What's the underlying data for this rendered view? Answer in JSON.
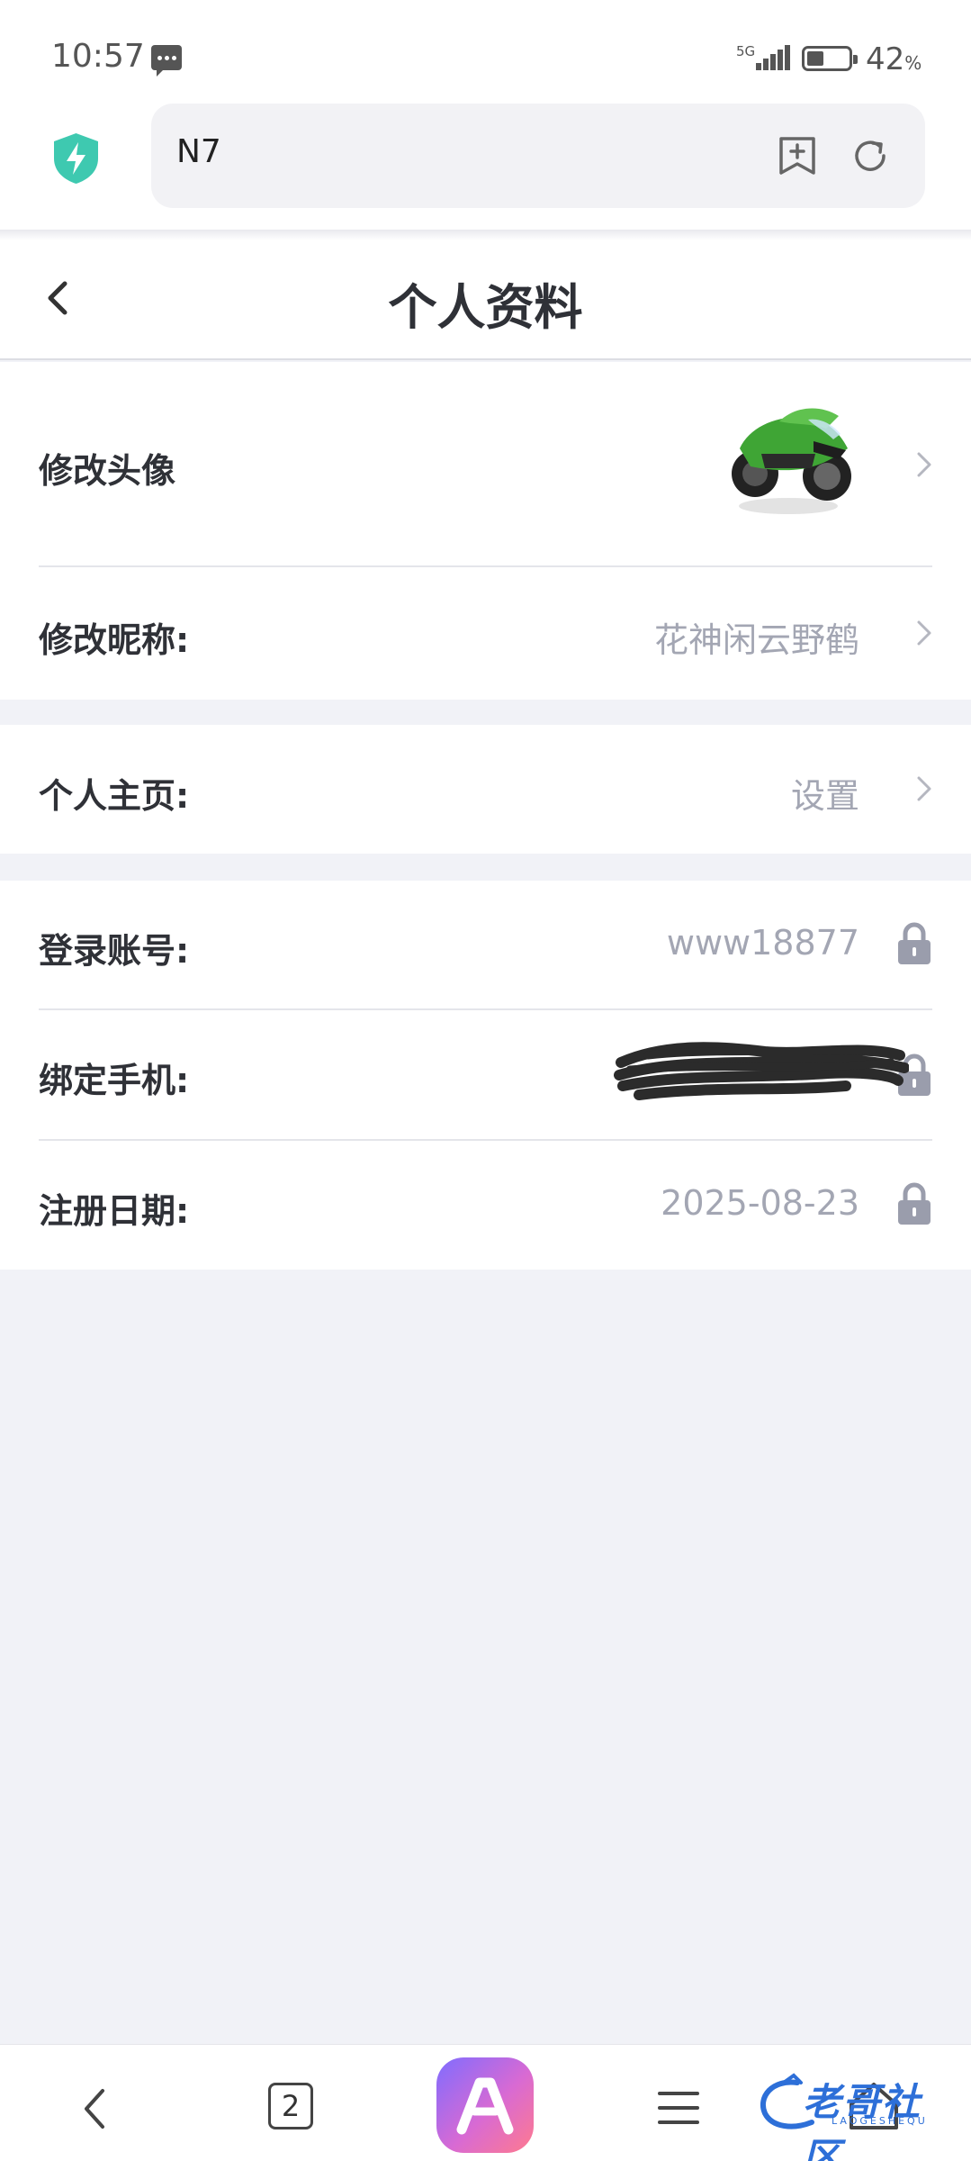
{
  "status_bar": {
    "time": "10:57",
    "network": "5G",
    "battery_percent": "42",
    "battery_unit": "%",
    "battery_level": 0.42
  },
  "browser": {
    "url_text": "N7"
  },
  "header": {
    "title": "个人资料"
  },
  "profile": {
    "avatar": {
      "label": "修改头像"
    },
    "nickname": {
      "label": "修改昵称:",
      "value": "花神闲云野鹤"
    },
    "homepage": {
      "label": "个人主页:",
      "value": "设置"
    },
    "account": {
      "label": "登录账号:",
      "value": "www18877"
    },
    "phone": {
      "label": "绑定手机:"
    },
    "register_date": {
      "label": "注册日期:",
      "value": "2025-08-23"
    }
  },
  "bottom_nav": {
    "tab_count": "2"
  },
  "watermark": {
    "text": "老哥社区",
    "sub": "LAOGESHEQU"
  },
  "colors": {
    "page_bg": "#f1f2f7",
    "label": "#2f3137",
    "value": "#a3a6b3",
    "shield": "#3ec9b0",
    "watermark": "#2d6fd8"
  }
}
